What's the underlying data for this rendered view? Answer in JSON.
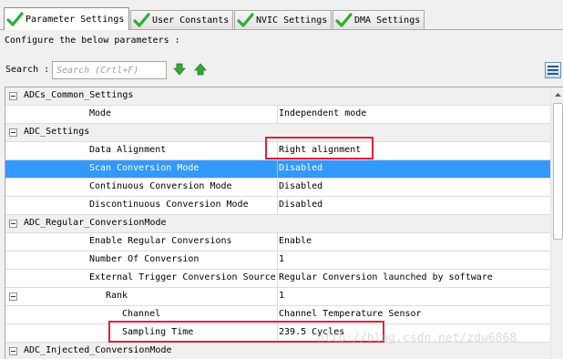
{
  "tabs": [
    {
      "label": "Parameter Settings",
      "active": true
    },
    {
      "label": "User Constants",
      "active": false
    },
    {
      "label": "NVIC Settings",
      "active": false
    },
    {
      "label": "DMA Settings",
      "active": false
    }
  ],
  "description": "Configure the below parameters :",
  "search": {
    "label": "Search :",
    "placeholder": "Search (Crtl+F)"
  },
  "groups": {
    "adcs_common": {
      "label": "ADCs_Common_Settings",
      "rows": [
        {
          "name": "Mode",
          "value": "Independent mode"
        }
      ]
    },
    "adc_settings": {
      "label": "ADC_Settings",
      "rows": [
        {
          "name": "Data Alignment",
          "value": "Right alignment"
        },
        {
          "name": "Scan Conversion Mode",
          "value": "Disabled"
        },
        {
          "name": "Continuous Conversion Mode",
          "value": "Disabled"
        },
        {
          "name": "Discontinuous Conversion Mode",
          "value": "Disabled"
        }
      ]
    },
    "adc_regular": {
      "label": "ADC_Regular_ConversionMode",
      "rows": [
        {
          "name": "Enable Regular Conversions",
          "value": "Enable"
        },
        {
          "name": "Number Of Conversion",
          "value": "1"
        },
        {
          "name": "External Trigger Conversion Source",
          "value": "Regular Conversion launched by software"
        },
        {
          "name": "Rank",
          "value": "1"
        },
        {
          "name": "Channel",
          "value": "Channel Temperature Sensor"
        },
        {
          "name": "Sampling Time",
          "value": "239.5 Cycles"
        }
      ]
    },
    "adc_injected": {
      "label": "ADC_Injected_ConversionMode"
    }
  },
  "watermark": "http://blog.csdn.net/zdw6868",
  "colors": {
    "selection": "#3399ff",
    "highlight_box": "#e0203a",
    "check_green": "#2fae2f"
  },
  "icons": [
    "check-icon",
    "arrow-down-icon",
    "arrow-up-icon",
    "list-view-icon",
    "collapse-icon"
  ]
}
